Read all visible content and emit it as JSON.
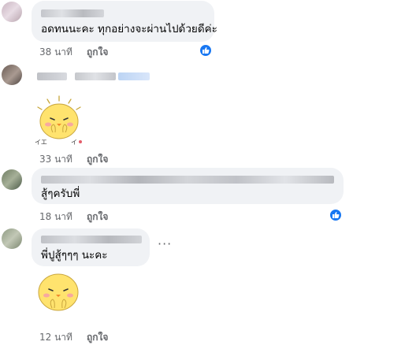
{
  "comments": [
    {
      "text": "อดทนนะคะ ทุกอย่างจะผ่านไปด้วยดีค่ะ",
      "time": "38 นาที",
      "like_label": "ถูกใจ",
      "reaction_icon": "like-thumb-icon"
    },
    {
      "text": "",
      "time": "33 นาที",
      "like_label": "ถูกใจ",
      "sticker": "chick-sticker-icon"
    },
    {
      "text": "สู้ๆครับพี่",
      "time": "18 นาที",
      "like_label": "ถูกใจ",
      "reaction_icon": "like-thumb-icon"
    },
    {
      "text": "พี่ปูสู้ๆๆๆ นะคะ",
      "time": "12 นาที",
      "like_label": "ถูกใจ",
      "more_icon": "more-options-icon",
      "sticker": "chick-sticker-icon"
    }
  ],
  "colors": {
    "bubble": "#f0f2f5",
    "meta_text": "#65676b",
    "like_blue": "#1877f2",
    "sticker_yellow": "#ffe36e"
  }
}
